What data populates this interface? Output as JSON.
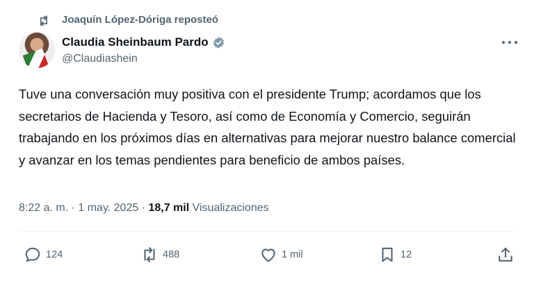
{
  "repost": {
    "label": "Joaquín López-Dóriga reposteó",
    "icon": "repost-icon"
  },
  "author": {
    "name": "Claudia Sheinbaum Pardo",
    "handle": "@Claudiashein",
    "verified_icon": "verified-badge-icon",
    "verified_color": "#829aab"
  },
  "tweet": {
    "text": "Tuve una conversación muy positiva con el presidente Trump; acordamos que los secretarios de Hacienda y Tesoro, así como de Economía y Comercio, seguirán trabajando en los próximos días en alternativas para mejorar nuestro balance comercial y avanzar en los temas pendientes para beneficio de ambos países.",
    "time": "8:22 a. m.",
    "separator1": " · ",
    "date": "1 may. 2025",
    "separator2": " · ",
    "views_count": "18,7 mil",
    "views_label": " Visualizaciones"
  },
  "actions": {
    "replies": "124",
    "reposts": "488",
    "likes": "1 mil",
    "bookmarks": "12"
  },
  "colors": {
    "text": "#0f1419",
    "secondary": "#536471",
    "divider": "#eff3f4"
  }
}
